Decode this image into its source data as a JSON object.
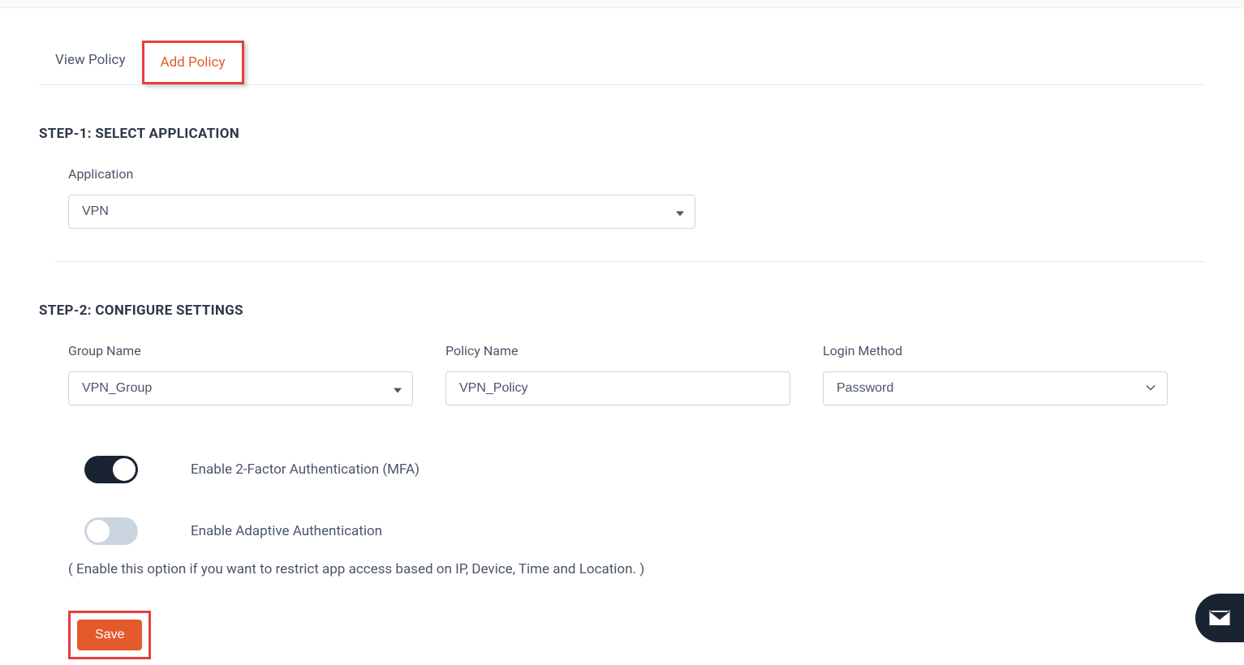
{
  "tabs": {
    "view": "View Policy",
    "add": "Add Policy"
  },
  "step1": {
    "heading": "STEP-1: SELECT APPLICATION",
    "application_label": "Application",
    "application_value": "VPN"
  },
  "step2": {
    "heading": "STEP-2: CONFIGURE SETTINGS",
    "group_name_label": "Group Name",
    "group_name_value": "VPN_Group",
    "policy_name_label": "Policy Name",
    "policy_name_value": "VPN_Policy",
    "login_method_label": "Login Method",
    "login_method_value": "Password"
  },
  "toggles": {
    "mfa_label": "Enable 2-Factor Authentication (MFA)",
    "adaptive_label": "Enable Adaptive Authentication",
    "adaptive_description": "( Enable this option if you want to restrict app access based on IP, Device, Time and Location. )"
  },
  "buttons": {
    "save": "Save"
  }
}
